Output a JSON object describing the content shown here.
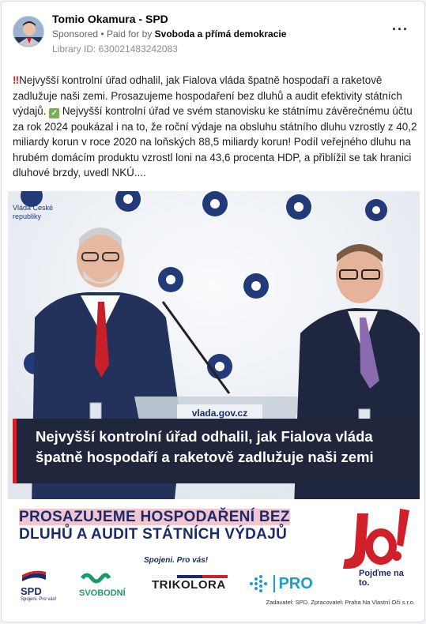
{
  "post": {
    "page_name": "Tomio Okamura - SPD",
    "sponsored_label": "Sponsored",
    "separator": "•",
    "paid_for_prefix": "Paid for by",
    "paid_for_name": "Svoboda a přímá demokracie",
    "library_id": "Library ID: 630021483242083",
    "more_icon": "more-horizontal-icon",
    "body_bang": "‼",
    "body_part1": "Nejvyšší kontrolní úřad odhalil, jak Fialova vláda špatně hospodaří a raketově zadlužuje naši zemi. Prosazujeme hospodaření bez dluhů a audit efektivity státních výdajů. ",
    "body_check_icon": "check-mark-button-icon",
    "body_part2": " Nejvyšší kontrolní úřad ve svém stanovisku ke státnímu závěrečnému účtu za rok 2024 poukázal i na to, že roční výdaje na obsluhu státního dluhu vzrostly z 40,2 miliardy korun v roce 2020 na loňských 88,5 miliardy korun! Podíl veřejného dluhu na hrubém domácím produktu vzrostl loni na 43,6 procenta HDP, a přiblížil se tak hranici dluhové brzdy, uvedl NKÚ...."
  },
  "ad_image": {
    "backdrop_text": "Vláda České republiky",
    "podium_text": "vlada.gov.cz",
    "banner_text": "Nejvyšší kontrolní úřad odhalil, jak Fialova vláda špatně hospodaří a raketově zadlužuje naši zemi",
    "slogan_line1": "PROSAZUJEME HOSPODAŘENÍ BEZ",
    "slogan_line2": "DLUHŮ A AUDIT STÁTNÍCH VÝDAJŮ",
    "tagline": "Spojeni. Pro vás!",
    "jo_logo": "Jo!",
    "jo_sub": "Pojďme na to.",
    "logos": {
      "spd": "SPD",
      "spd_sub": "Spojeni. Pro vás!",
      "svobodni": "SVOBODNÍ",
      "trikolora": "TRIKOLORA",
      "pro": "PRO"
    },
    "credit": "Zadavatel: SPD. Zpracovatel: Praha Na Vlastní Oči s.r.o.",
    "colors": {
      "navy": "#1b2a6b",
      "red": "#d0202a",
      "banner_bg": "#20263b"
    }
  }
}
